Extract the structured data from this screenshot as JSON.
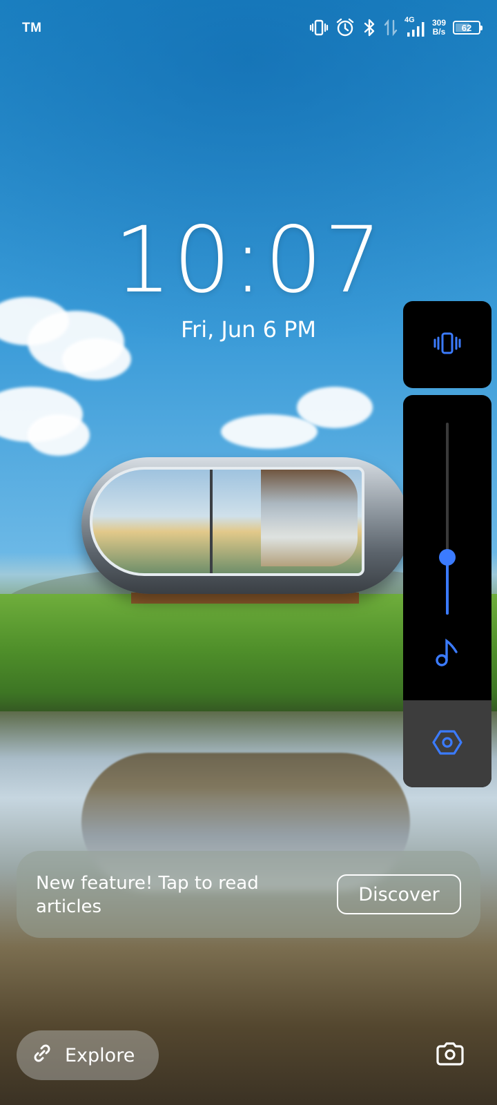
{
  "status_bar": {
    "carrier": "TM",
    "network": "4G",
    "net_speed_value": "309",
    "net_speed_unit": "B/s",
    "battery": "62",
    "battery_level": 0.62,
    "icons": [
      "vibrate-icon",
      "alarm-icon",
      "bluetooth-icon",
      "data-arrows-icon",
      "signal-icon",
      "battery-icon"
    ]
  },
  "lock": {
    "time": "10:07",
    "date": "Fri, Jun 6 PM"
  },
  "volume_panel": {
    "mode_icon": "vibrate-icon",
    "level": 0.3,
    "stream_icon": "music-note-icon",
    "settings_icon": "settings-hex-icon",
    "accent_color": "#3b7bff"
  },
  "banner": {
    "message": "New feature! Tap to read articles",
    "action": "Discover"
  },
  "bottom": {
    "explore_label": "Explore",
    "explore_icon": "link-icon",
    "camera_icon": "camera-icon"
  }
}
